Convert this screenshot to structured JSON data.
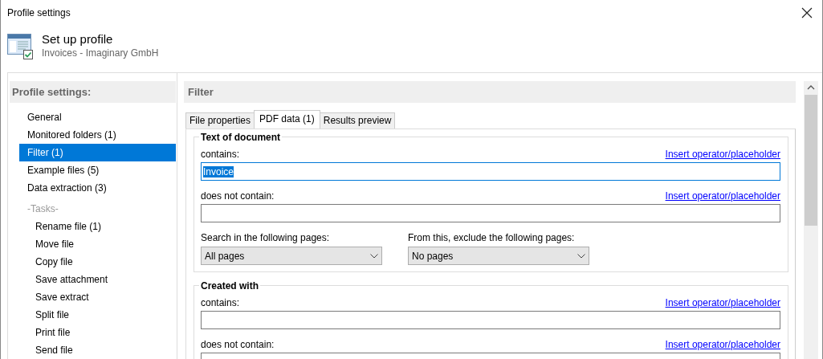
{
  "window": {
    "title": "Profile settings"
  },
  "header": {
    "title": "Set up profile",
    "subtitle": "Invoices - Imaginary GmbH"
  },
  "sidebar": {
    "heading": "Profile settings:",
    "items": [
      {
        "label": "General",
        "selected": false
      },
      {
        "label": "Monitored folders (1)",
        "selected": false
      },
      {
        "label": "Filter (1)",
        "selected": true
      },
      {
        "label": "Example files (5)",
        "selected": false
      },
      {
        "label": "Data extraction (3)",
        "selected": false
      }
    ],
    "tasks_heading": "-Tasks-",
    "tasks": [
      {
        "label": "Rename file (1)",
        "selected": false
      },
      {
        "label": "Move file",
        "selected": false
      },
      {
        "label": "Copy file",
        "selected": false
      },
      {
        "label": "Save attachment",
        "selected": false
      },
      {
        "label": "Save extract",
        "selected": false
      },
      {
        "label": "Split file",
        "selected": false
      },
      {
        "label": "Print file",
        "selected": false
      },
      {
        "label": "Send file",
        "selected": false
      }
    ]
  },
  "panel": {
    "heading": "Filter",
    "tabs": [
      {
        "label": "File properties",
        "selected": false
      },
      {
        "label": "PDF data (1)",
        "selected": true
      },
      {
        "label": "Results preview",
        "selected": false
      }
    ],
    "groups": [
      {
        "title": "Text of document",
        "fields": [
          {
            "label": "contains:",
            "link": "Insert operator/placeholder",
            "value": "Invoice",
            "focused": true
          },
          {
            "label": "does not contain:",
            "link": "Insert operator/placeholder",
            "focused": false
          }
        ],
        "selects": [
          {
            "label": "Search in the following pages:",
            "value": "All pages"
          },
          {
            "label": "From this, exclude the following pages:",
            "value": "No pages"
          }
        ]
      },
      {
        "title": "Created with",
        "fields": [
          {
            "label": "contains:",
            "link": "Insert operator/placeholder",
            "focused": false
          },
          {
            "label": "does not contain:",
            "link": "Insert operator/placeholder",
            "focused": false
          }
        ]
      }
    ]
  }
}
